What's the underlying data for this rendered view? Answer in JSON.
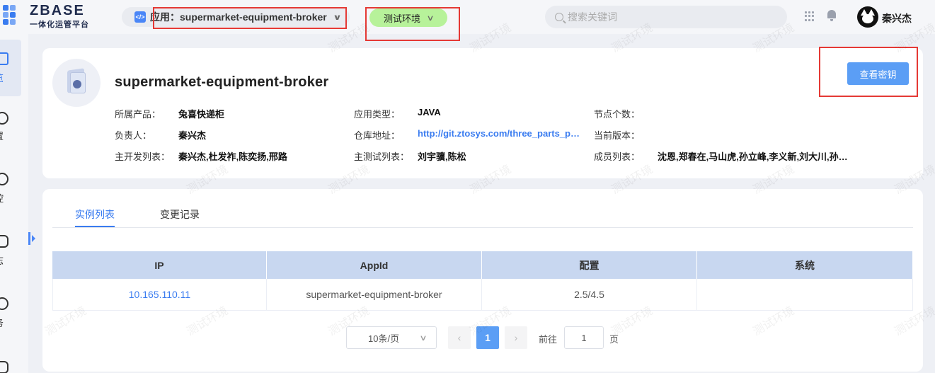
{
  "header": {
    "logo_title": "ZBASE",
    "logo_subtitle": "一体化运管平台",
    "app_select_label": "应用：supermarket-equipment-broker",
    "env_select_label": "测试环境",
    "search_placeholder": "搜索关键词",
    "user_name": "秦兴杰"
  },
  "sidebar": {
    "items": [
      {
        "label": "览"
      },
      {
        "label": "置"
      },
      {
        "label": "控"
      },
      {
        "label": "志"
      },
      {
        "label": "务"
      }
    ]
  },
  "app_info": {
    "name": "supermarket-equipment-broker",
    "view_secret_label": "查看密钥",
    "fields": {
      "product_label": "所属产品：",
      "product_value": "兔喜快递柜",
      "app_type_label": "应用类型：",
      "app_type_value": "JAVA",
      "node_count_label": "节点个数：",
      "node_count_value": "",
      "owner_label": "负责人：",
      "owner_value": "秦兴杰",
      "repo_label": "仓库地址：",
      "repo_value": "http://git.ztosys.com/three_parts_p…",
      "version_label": "当前版本：",
      "version_value": "",
      "dev_label": "主开发列表：",
      "dev_value": "秦兴杰,杜发祚,陈奕扬,邢路",
      "tester_label": "主测试列表：",
      "tester_value": "刘宇骥,陈松",
      "members_label": "成员列表：",
      "members_value": "沈恩,郑春在,马山虎,孙立峰,李义新,刘大川,孙…"
    }
  },
  "tabs": [
    {
      "label": "实例列表",
      "active": true
    },
    {
      "label": "变更记录",
      "active": false
    }
  ],
  "table": {
    "columns": [
      "IP",
      "AppId",
      "配置",
      "系统"
    ],
    "rows": [
      {
        "ip": "10.165.110.11",
        "appid": "supermarket-equipment-broker",
        "config": "2.5/4.5",
        "system": ""
      }
    ]
  },
  "pagination": {
    "page_size": "10条/页",
    "current_page": "1",
    "goto_label": "前往",
    "goto_value": "1",
    "page_suffix": "页"
  },
  "watermark": "测试环境",
  "colors": {
    "accent": "#3a7cf0",
    "env_badge": "#b7f29a",
    "table_header": "#c8d7f0",
    "annotation_box": "#e53935"
  }
}
